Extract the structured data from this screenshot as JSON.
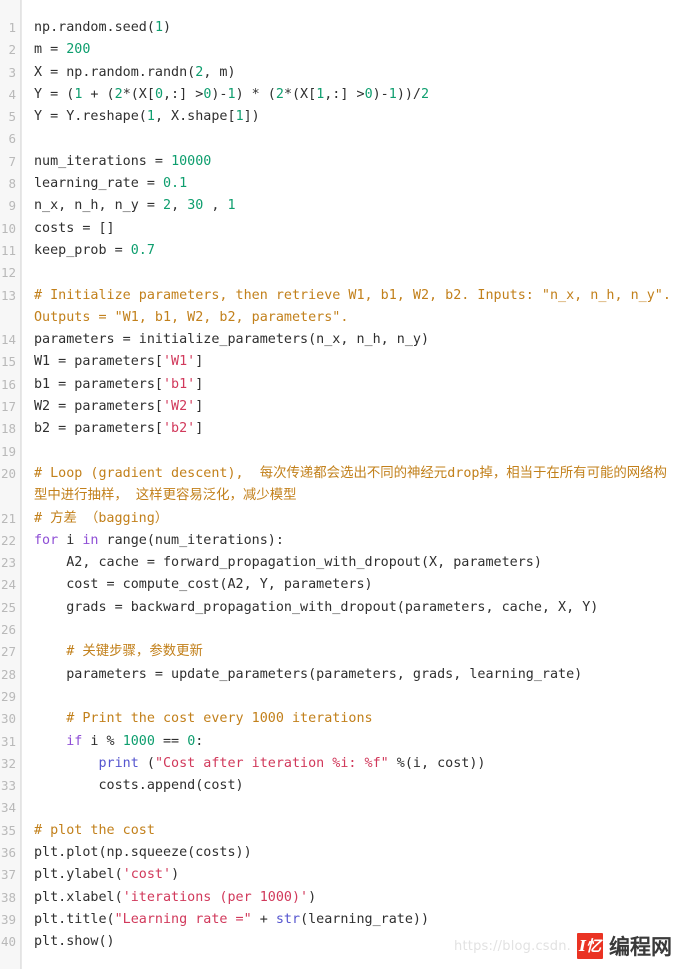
{
  "editor": {
    "language": "python",
    "first_line_number": 1,
    "total_lines": 40,
    "colors": {
      "background": "#ffffff",
      "gutter_background": "#f7f7f7",
      "line_number": "#b9b9b9",
      "text": "#2f2f2f",
      "number_literal": "#0e9e6e",
      "string_literal": "#d1395b",
      "comment": "#c2801b",
      "keyword": "#8f4fd6",
      "builtin": "#5656cf"
    }
  },
  "lines": [
    {
      "n": "1",
      "tokens": [
        {
          "t": "plain",
          "s": "np.random.seed("
        },
        {
          "t": "num",
          "s": "1"
        },
        {
          "t": "plain",
          "s": ")"
        }
      ]
    },
    {
      "n": "2",
      "tokens": [
        {
          "t": "plain",
          "s": "m = "
        },
        {
          "t": "num",
          "s": "200"
        }
      ]
    },
    {
      "n": "3",
      "tokens": [
        {
          "t": "plain",
          "s": "X = np.random.randn("
        },
        {
          "t": "num",
          "s": "2"
        },
        {
          "t": "plain",
          "s": ", m)"
        }
      ]
    },
    {
      "n": "4",
      "tokens": [
        {
          "t": "plain",
          "s": "Y = ("
        },
        {
          "t": "num",
          "s": "1"
        },
        {
          "t": "plain",
          "s": " + ("
        },
        {
          "t": "num",
          "s": "2"
        },
        {
          "t": "plain",
          "s": "*(X["
        },
        {
          "t": "num",
          "s": "0"
        },
        {
          "t": "plain",
          "s": ",:] >"
        },
        {
          "t": "num",
          "s": "0"
        },
        {
          "t": "plain",
          "s": ")-"
        },
        {
          "t": "num",
          "s": "1"
        },
        {
          "t": "plain",
          "s": ") * ("
        },
        {
          "t": "num",
          "s": "2"
        },
        {
          "t": "plain",
          "s": "*(X["
        },
        {
          "t": "num",
          "s": "1"
        },
        {
          "t": "plain",
          "s": ",:] >"
        },
        {
          "t": "num",
          "s": "0"
        },
        {
          "t": "plain",
          "s": ")-"
        },
        {
          "t": "num",
          "s": "1"
        },
        {
          "t": "plain",
          "s": "))/"
        },
        {
          "t": "num",
          "s": "2"
        }
      ]
    },
    {
      "n": "5",
      "tokens": [
        {
          "t": "plain",
          "s": "Y = Y.reshape("
        },
        {
          "t": "num",
          "s": "1"
        },
        {
          "t": "plain",
          "s": ", X.shape["
        },
        {
          "t": "num",
          "s": "1"
        },
        {
          "t": "plain",
          "s": "])"
        }
      ]
    },
    {
      "n": "6",
      "tokens": []
    },
    {
      "n": "7",
      "tokens": [
        {
          "t": "plain",
          "s": "num_iterations = "
        },
        {
          "t": "num",
          "s": "10000"
        }
      ]
    },
    {
      "n": "8",
      "tokens": [
        {
          "t": "plain",
          "s": "learning_rate = "
        },
        {
          "t": "num",
          "s": "0.1"
        }
      ]
    },
    {
      "n": "9",
      "tokens": [
        {
          "t": "plain",
          "s": "n_x, n_h, n_y = "
        },
        {
          "t": "num",
          "s": "2"
        },
        {
          "t": "plain",
          "s": ", "
        },
        {
          "t": "num",
          "s": "30"
        },
        {
          "t": "plain",
          "s": " , "
        },
        {
          "t": "num",
          "s": "1"
        }
      ]
    },
    {
      "n": "10",
      "tokens": [
        {
          "t": "plain",
          "s": "costs = []"
        }
      ]
    },
    {
      "n": "11",
      "tokens": [
        {
          "t": "plain",
          "s": "keep_prob = "
        },
        {
          "t": "num",
          "s": "0.7"
        }
      ]
    },
    {
      "n": "12",
      "tokens": []
    },
    {
      "n": "13",
      "tokens": [
        {
          "t": "com",
          "s": "# Initialize parameters, then retrieve W1, b1, W2, b2. Inputs: \"n_x, n_h, n_y\". Outputs = \"W1, b1, W2, b2, parameters\"."
        }
      ]
    },
    {
      "n": "14",
      "tokens": [
        {
          "t": "plain",
          "s": "parameters = initialize_parameters(n_x, n_h, n_y)"
        }
      ]
    },
    {
      "n": "15",
      "tokens": [
        {
          "t": "plain",
          "s": "W1 = parameters["
        },
        {
          "t": "str",
          "s": "'W1'"
        },
        {
          "t": "plain",
          "s": "]"
        }
      ]
    },
    {
      "n": "16",
      "tokens": [
        {
          "t": "plain",
          "s": "b1 = parameters["
        },
        {
          "t": "str",
          "s": "'b1'"
        },
        {
          "t": "plain",
          "s": "]"
        }
      ]
    },
    {
      "n": "17",
      "tokens": [
        {
          "t": "plain",
          "s": "W2 = parameters["
        },
        {
          "t": "str",
          "s": "'W2'"
        },
        {
          "t": "plain",
          "s": "]"
        }
      ]
    },
    {
      "n": "18",
      "tokens": [
        {
          "t": "plain",
          "s": "b2 = parameters["
        },
        {
          "t": "str",
          "s": "'b2'"
        },
        {
          "t": "plain",
          "s": "]"
        }
      ]
    },
    {
      "n": "19",
      "tokens": []
    },
    {
      "n": "20",
      "tokens": [
        {
          "t": "com",
          "s": "# Loop (gradient descent),  每次传递都会选出不同的神经元drop掉，相当于在所有可能的网络构型中进行抽样， 这样更容易泛化，减少模型"
        }
      ]
    },
    {
      "n": "21",
      "tokens": [
        {
          "t": "com",
          "s": "# 方差 （bagging）"
        }
      ]
    },
    {
      "n": "22",
      "tokens": [
        {
          "t": "kw",
          "s": "for"
        },
        {
          "t": "plain",
          "s": " i "
        },
        {
          "t": "kw",
          "s": "in"
        },
        {
          "t": "plain",
          "s": " range(num_iterations):"
        }
      ]
    },
    {
      "n": "23",
      "tokens": [
        {
          "t": "plain",
          "s": "    A2, cache = forward_propagation_with_dropout(X, parameters)"
        }
      ]
    },
    {
      "n": "24",
      "tokens": [
        {
          "t": "plain",
          "s": "    cost = compute_cost(A2, Y, parameters)"
        }
      ]
    },
    {
      "n": "25",
      "tokens": [
        {
          "t": "plain",
          "s": "    grads = backward_propagation_with_dropout(parameters, cache, X, Y)"
        }
      ]
    },
    {
      "n": "26",
      "tokens": []
    },
    {
      "n": "27",
      "tokens": [
        {
          "t": "plain",
          "s": "    "
        },
        {
          "t": "com",
          "s": "# 关键步骤，参数更新"
        }
      ]
    },
    {
      "n": "28",
      "tokens": [
        {
          "t": "plain",
          "s": "    parameters = update_parameters(parameters, grads, learning_rate)"
        }
      ]
    },
    {
      "n": "29",
      "tokens": []
    },
    {
      "n": "30",
      "tokens": [
        {
          "t": "plain",
          "s": "    "
        },
        {
          "t": "com",
          "s": "# Print the cost every 1000 iterations"
        }
      ]
    },
    {
      "n": "31",
      "tokens": [
        {
          "t": "plain",
          "s": "    "
        },
        {
          "t": "kw",
          "s": "if"
        },
        {
          "t": "plain",
          "s": " i % "
        },
        {
          "t": "num",
          "s": "1000"
        },
        {
          "t": "plain",
          "s": " == "
        },
        {
          "t": "num",
          "s": "0"
        },
        {
          "t": "plain",
          "s": ":"
        }
      ]
    },
    {
      "n": "32",
      "tokens": [
        {
          "t": "plain",
          "s": "        "
        },
        {
          "t": "bi",
          "s": "print"
        },
        {
          "t": "plain",
          "s": " ("
        },
        {
          "t": "str",
          "s": "\"Cost after iteration %i: %f\""
        },
        {
          "t": "plain",
          "s": " %(i, cost))"
        }
      ]
    },
    {
      "n": "33",
      "tokens": [
        {
          "t": "plain",
          "s": "        costs.append(cost)"
        }
      ]
    },
    {
      "n": "34",
      "tokens": []
    },
    {
      "n": "35",
      "tokens": [
        {
          "t": "com",
          "s": "# plot the cost"
        }
      ]
    },
    {
      "n": "36",
      "tokens": [
        {
          "t": "plain",
          "s": "plt.plot(np.squeeze(costs))"
        }
      ]
    },
    {
      "n": "37",
      "tokens": [
        {
          "t": "plain",
          "s": "plt.ylabel("
        },
        {
          "t": "str",
          "s": "'cost'"
        },
        {
          "t": "plain",
          "s": ")"
        }
      ]
    },
    {
      "n": "38",
      "tokens": [
        {
          "t": "plain",
          "s": "plt.xlabel("
        },
        {
          "t": "str",
          "s": "'iterations (per 1000)'"
        },
        {
          "t": "plain",
          "s": ")"
        }
      ]
    },
    {
      "n": "39",
      "tokens": [
        {
          "t": "plain",
          "s": "plt.title("
        },
        {
          "t": "str",
          "s": "\"Learning rate =\""
        },
        {
          "t": "plain",
          "s": " + "
        },
        {
          "t": "bi",
          "s": "str"
        },
        {
          "t": "plain",
          "s": "(learning_rate))"
        }
      ]
    },
    {
      "n": "40",
      "tokens": [
        {
          "t": "plain",
          "s": "plt.show()"
        }
      ]
    }
  ],
  "watermark": {
    "url": "https://blog.csdn.",
    "logo_text": "I忆",
    "brand": "编程网",
    "logo_color": "#ea3323"
  }
}
